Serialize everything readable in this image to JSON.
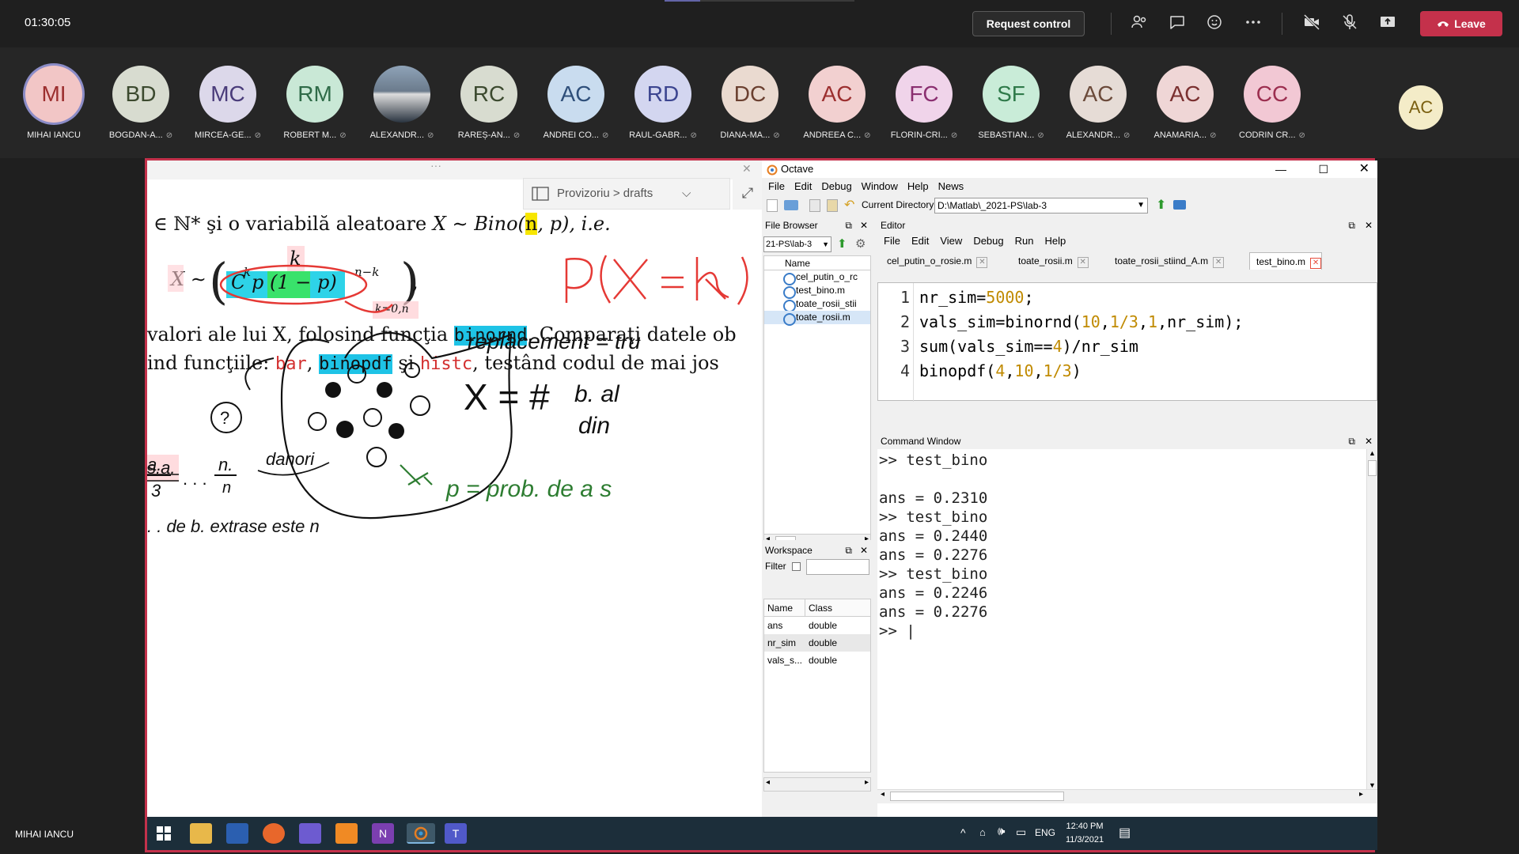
{
  "topbar": {
    "timer": "01:30:05",
    "request_control": "Request control",
    "leave": "Leave"
  },
  "participants": [
    {
      "initials": "MI",
      "name": "MIHAI IANCU",
      "color": "#f2c6c6",
      "text": "#9c2f2f",
      "muted": false
    },
    {
      "initials": "BD",
      "name": "BOGDAN-A...",
      "color": "#d8dcd0",
      "text": "#3c4a2f",
      "muted": true
    },
    {
      "initials": "MC",
      "name": "MIRCEA-GE...",
      "color": "#dcd8ea",
      "text": "#4a3c7a",
      "muted": true
    },
    {
      "initials": "RM",
      "name": "ROBERT M...",
      "color": "#c9e8d6",
      "text": "#2f6b48",
      "muted": true
    },
    {
      "initials": "",
      "name": "ALEXANDR...",
      "color": "#7a8899",
      "text": "#ffffff",
      "muted": true,
      "photo": true
    },
    {
      "initials": "RC",
      "name": "RAREȘ-AN...",
      "color": "#d8dcd0",
      "text": "#3c4a2f",
      "muted": true
    },
    {
      "initials": "AC",
      "name": "ANDREI CO...",
      "color": "#c9dcef",
      "text": "#2f4f7a",
      "muted": true
    },
    {
      "initials": "RD",
      "name": "RAUL-GABR...",
      "color": "#d3d6f0",
      "text": "#3c4590",
      "muted": true
    },
    {
      "initials": "DC",
      "name": "DIANA-MA...",
      "color": "#eadad0",
      "text": "#6b4030",
      "muted": true
    },
    {
      "initials": "AC",
      "name": "ANDREEA C...",
      "color": "#f2d0d0",
      "text": "#9c2f2f",
      "muted": true
    },
    {
      "initials": "FC",
      "name": "FLORIN-CRI...",
      "color": "#f0d4ea",
      "text": "#8a2f70",
      "muted": true
    },
    {
      "initials": "SF",
      "name": "SEBASTIAN...",
      "color": "#c9ecd8",
      "text": "#2f7a4a",
      "muted": true
    },
    {
      "initials": "AC",
      "name": "ALEXANDR...",
      "color": "#e6dcd6",
      "text": "#6b4a3a",
      "muted": true
    },
    {
      "initials": "AC",
      "name": "ANAMARIA...",
      "color": "#efd6d6",
      "text": "#7a3030",
      "muted": true
    },
    {
      "initials": "CC",
      "name": "CODRIN CR...",
      "color": "#f2c8d4",
      "text": "#9c2f50",
      "muted": true
    }
  ],
  "self_view": {
    "initials": "AC",
    "color": "#f4ecc8",
    "text": "#7a5f10"
  },
  "pdf": {
    "breadcrumb": "Provizoriu > drafts",
    "line1_pre": "∈ ℕ* şi o variabilă aleatoare ",
    "line1_math": "X ∼ Bino(",
    "line1_n": "n",
    "line1_post": ", p), i.e.",
    "formula_X": "X ∼",
    "formula_body": "C p (1 − p)",
    "formula_k": "k",
    "formula_sub": "k=0,n",
    "formula_sup_k": "k",
    "formula_sup_nk": "n−k",
    "line3_pre": "valori ale lui X, folosind funcţia ",
    "line3_fn": "binornd",
    "line3_post": ". Comparaţi datele ob",
    "line4_pre": "ind funcţiile: ",
    "line4_bar": "bar",
    "line4_sep1": ", ",
    "line4_binopdf": "binopdf",
    "line4_si": " şi ",
    "line4_histc": "histc",
    "line4_post": ", testând codul de mai jos"
  },
  "octave": {
    "title": "Octave",
    "menu": [
      "File",
      "Edit",
      "Debug",
      "Window",
      "Help",
      "News"
    ],
    "current_dir_label": "Current Directory:",
    "current_dir": "D:\\Matlab\\_2021-PS\\lab-3",
    "file_browser": {
      "title": "File Browser",
      "path": "21-PS\\lab-3",
      "col": "Name",
      "files": [
        "cel_putin_o_rc",
        "test_bino.m",
        "toate_rosii_stii",
        "toate_rosii.m"
      ]
    },
    "workspace": {
      "title": "Workspace",
      "filter": "Filter",
      "cols": [
        "Name",
        "Class"
      ],
      "rows": [
        {
          "name": "ans",
          "class": "double"
        },
        {
          "name": "nr_sim",
          "class": "double"
        },
        {
          "name": "vals_s...",
          "class": "double"
        }
      ]
    },
    "editor": {
      "title": "Editor",
      "menu": [
        "File",
        "Edit",
        "View",
        "Debug",
        "Run",
        "Help"
      ],
      "tabs": [
        "cel_putin_o_rosie.m",
        "toate_rosii.m",
        "toate_rosii_stiind_A.m",
        "test_bino.m"
      ],
      "lines": [
        {
          "n": "1",
          "code": "nr_sim=5000;"
        },
        {
          "n": "2",
          "code": "vals_sim=binornd(10,1/3,1,nr_sim);"
        },
        {
          "n": "3",
          "code": "sum(vals_sim==4)/nr_sim"
        },
        {
          "n": "4",
          "code": "binopdf(4,10,1/3)"
        }
      ]
    },
    "command_window": {
      "title": "Command Window",
      "lines": [
        ">> test_bino",
        "",
        "ans = 0.2310",
        ">> test_bino",
        "ans = 0.2440",
        "ans = 0.2276",
        ">> test_bino",
        "ans = 0.2246",
        "ans = 0.2276",
        ">> |"
      ]
    }
  },
  "taskbar": {
    "lang": "ENG",
    "time": "12:40 PM",
    "date": "11/3/2021"
  },
  "presenter_name": "MIHAI IANCU"
}
